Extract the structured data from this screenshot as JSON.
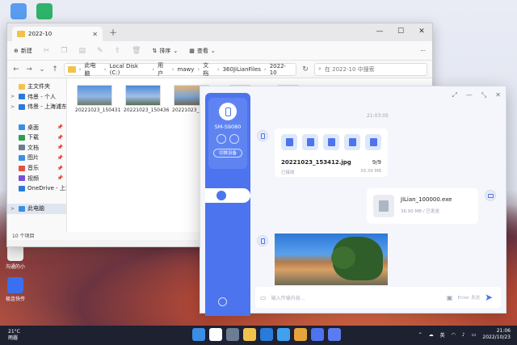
{
  "desktop": {
    "icons": [
      {
        "label": "",
        "color": "#5a9cf0"
      },
      {
        "label": "",
        "color": "#2fb36a"
      },
      {
        "label": "沟通的小",
        "color": "#f0f0f0"
      },
      {
        "label": "极连快传",
        "color": "#3a6ff0"
      }
    ]
  },
  "explorer": {
    "tab_title": "2022-10",
    "toolbar": {
      "new": "新建",
      "sort": "排序",
      "view": "查看"
    },
    "breadcrumbs": [
      "此电脑",
      "Local Disk (C:)",
      "用户",
      "mawy",
      "文档",
      "360JiLianFiles",
      "2022-10"
    ],
    "search_placeholder": "在 2022-10 中搜索",
    "sidebar": [
      {
        "label": "主文件夹",
        "color": "#f3c24c",
        "pin": false,
        "expander": ""
      },
      {
        "label": "伟景 - 个人",
        "color": "#2a7bd9",
        "pin": false,
        "expander": ">"
      },
      {
        "label": "伟景 - 上海浦东新区",
        "color": "#2a7bd9",
        "pin": false,
        "expander": ">"
      },
      {
        "label": "",
        "color": "transparent",
        "pin": false,
        "expander": ""
      },
      {
        "label": "桌面",
        "color": "#3a8ee6",
        "pin": true,
        "expander": ""
      },
      {
        "label": "下载",
        "color": "#2d9d4f",
        "pin": true,
        "expander": ""
      },
      {
        "label": "文档",
        "color": "#6b7c93",
        "pin": true,
        "expander": ""
      },
      {
        "label": "图片",
        "color": "#3a8ee6",
        "pin": true,
        "expander": ""
      },
      {
        "label": "音乐",
        "color": "#e5533d",
        "pin": true,
        "expander": ""
      },
      {
        "label": "视频",
        "color": "#7a4fd6",
        "pin": true,
        "expander": ""
      },
      {
        "label": "OneDrive - 上海",
        "color": "#2a7bd9",
        "pin": false,
        "expander": ""
      },
      {
        "label": "",
        "color": "transparent",
        "pin": false,
        "expander": ""
      },
      {
        "label": "此电脑",
        "color": "#3a8ee6",
        "pin": false,
        "expander": ">"
      }
    ],
    "files": [
      {
        "name": "20221023_150431",
        "orientation": "land",
        "colors": [
          "#5a93d8",
          "#8fb7e6",
          "#6f7a6a"
        ]
      },
      {
        "name": "20221023_150436",
        "orientation": "land",
        "colors": [
          "#4c86d4",
          "#9fc0ea",
          "#5b6c55"
        ]
      },
      {
        "name": "20221023_150512",
        "orientation": "land",
        "colors": [
          "#e0b57c",
          "#7fa6d6",
          "#6e6b5a"
        ]
      },
      {
        "name": "20221023_153517",
        "orientation": "port",
        "colors": [
          "#3f7b2f",
          "#c4d86c",
          "#2c5a22"
        ]
      },
      {
        "name": "20221023_153529",
        "orientation": "port",
        "colors": [
          "#3d6e2c",
          "#a8c95a",
          "#29501f"
        ]
      }
    ],
    "status": "10 个项目"
  },
  "app": {
    "device_name": "SM-S9080",
    "switch_label": "切换设备",
    "time": "21:03:05",
    "transfer": {
      "filename": "20221023_153412.jpg",
      "progress": "9/9",
      "status": "已接收",
      "size": "39.39 MB"
    },
    "sent_file": {
      "filename": "JiLian_100000.exe",
      "meta": "36.90 MB / 已发送"
    },
    "input_placeholder": "输入传输内容...",
    "input_hint": "Enter 发送",
    "accent_color": "#4c74ee"
  },
  "taskbar": {
    "weather_temp": "21°C",
    "weather_desc": "雨霾",
    "lang": "英",
    "time": "21:06",
    "date": "2022/10/23",
    "apps": [
      "#3a8ee6",
      "#ffffff",
      "#6b7c93",
      "#f3c24c",
      "#2a7bd9",
      "#3fa1f0",
      "#e8a33c",
      "#4c74ee",
      "#5b7cf0"
    ]
  }
}
